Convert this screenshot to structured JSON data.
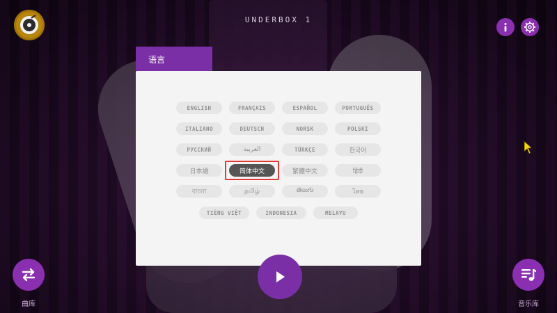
{
  "header": {
    "app_title": "UNDERBOX  1"
  },
  "panel": {
    "tab_label": "语言",
    "languages": [
      [
        "ENGLISH",
        "FRANÇAIS",
        "ESPAÑOL",
        "PORTUGUÊS"
      ],
      [
        "ITALIANO",
        "DEUTSCH",
        "NORSK",
        "POLSKI"
      ],
      [
        "РУССКИЙ",
        "العربية",
        "TÜRKÇE",
        "한국어"
      ],
      [
        "日本語",
        "简体中文",
        "繁體中文",
        "हिंदी"
      ],
      [
        "বাংলা",
        "தமிழ்",
        "తెలుగు",
        "ไทย"
      ],
      [
        "TIẾNG VIỆT",
        "INDONESIA",
        "MELAYU"
      ]
    ],
    "selected": "简体中文"
  },
  "bottom": {
    "left_label": "曲库",
    "right_label": "音乐库"
  },
  "colors": {
    "accent": "#8a2fb0",
    "tab": "#7b2fa6",
    "selected_button": "#555555",
    "highlight_border": "#e53935",
    "logo_gold": "#b8860b"
  },
  "icons": {
    "logo": "record-disc-icon",
    "info": "info-icon",
    "settings": "gear-icon",
    "play": "play-icon",
    "swap": "swap-arrows-icon",
    "library": "music-list-icon",
    "cursor": "mouse-pointer-icon"
  }
}
